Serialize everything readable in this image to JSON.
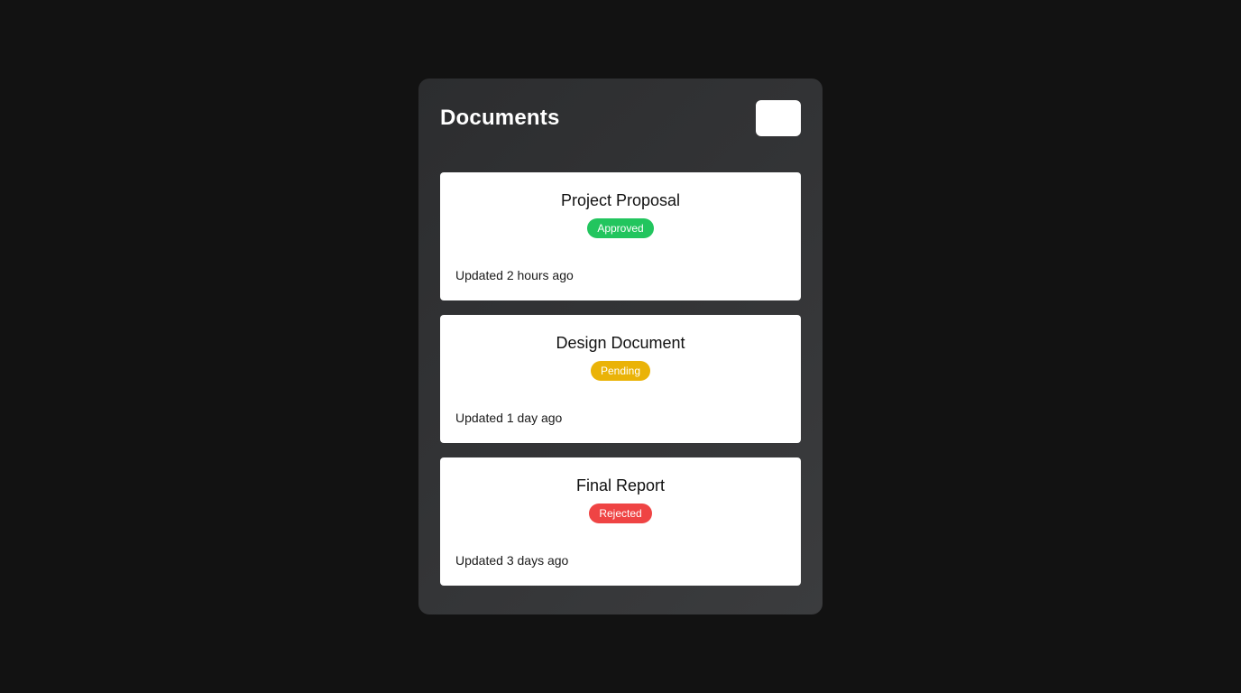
{
  "panel": {
    "title": "Documents"
  },
  "documents": [
    {
      "title": "Project Proposal",
      "status": "Approved",
      "status_color": "#22c55e",
      "updated": "Updated 2 hours ago"
    },
    {
      "title": "Design Document",
      "status": "Pending",
      "status_color": "#eab308",
      "updated": "Updated 1 day ago"
    },
    {
      "title": "Final Report",
      "status": "Rejected",
      "status_color": "#ef4444",
      "updated": "Updated 3 days ago"
    }
  ]
}
